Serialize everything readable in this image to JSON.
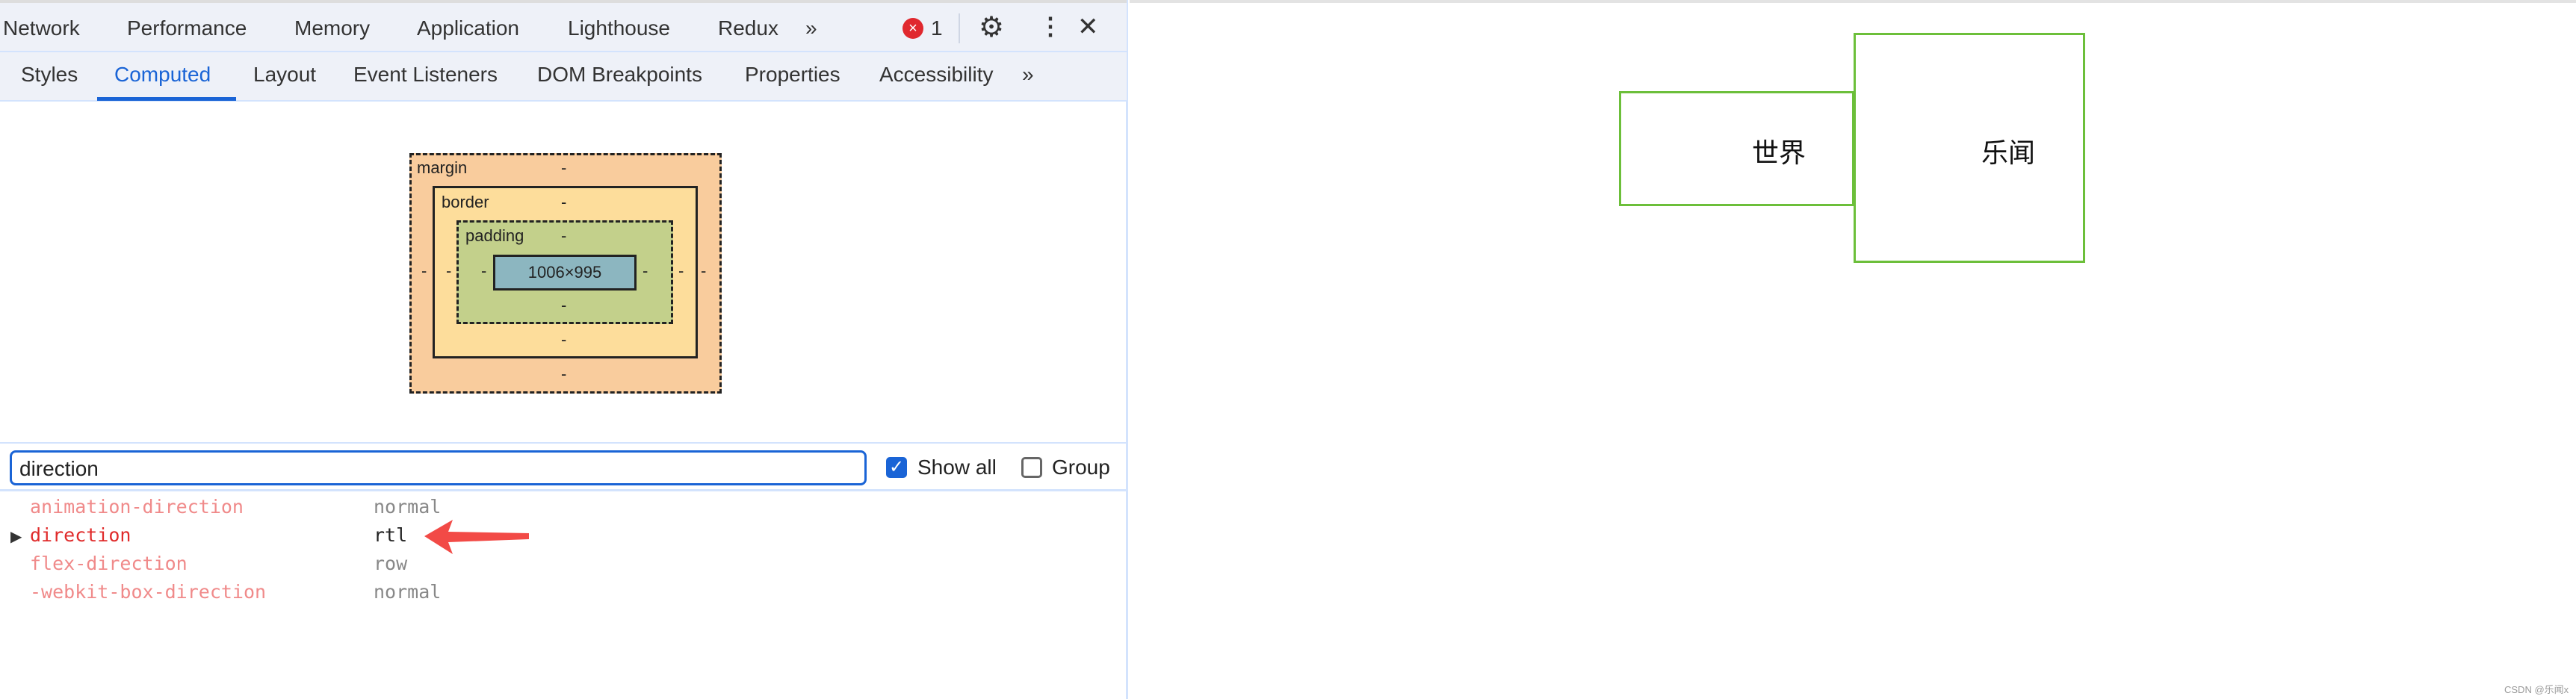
{
  "devtools": {
    "main_tabs": [
      "Network",
      "Performance",
      "Memory",
      "Application",
      "Lighthouse",
      "Redux"
    ],
    "more_tabs_icon": "chevron-double-right-icon",
    "error_count": "1",
    "sub_tabs": [
      "Styles",
      "Computed",
      "Layout",
      "Event Listeners",
      "DOM Breakpoints",
      "Properties",
      "Accessibility"
    ],
    "active_sub_tab": "Computed",
    "box_model": {
      "margin_label": "margin",
      "border_label": "border",
      "padding_label": "padding",
      "content_size": "1006×995",
      "placeholder": "-",
      "colors": {
        "margin": "#f9cc9d",
        "border": "#fddd9b",
        "padding": "#c3d08b",
        "content": "#8cb6c0"
      }
    },
    "filter": {
      "value": "direction",
      "show_all_label": "Show all",
      "show_all_checked": true,
      "group_label": "Group",
      "group_checked": false
    },
    "properties": [
      {
        "name": "animation-direction",
        "value": "normal"
      },
      {
        "name": "direction",
        "value": "rtl"
      },
      {
        "name": "flex-direction",
        "value": "row"
      },
      {
        "name": "-webkit-box-direction",
        "value": "normal"
      }
    ]
  },
  "page": {
    "box1_text": "世界",
    "box2_text": "乐闻",
    "border_color": "#6cbf3a",
    "watermark": "CSDN @乐闻x"
  }
}
